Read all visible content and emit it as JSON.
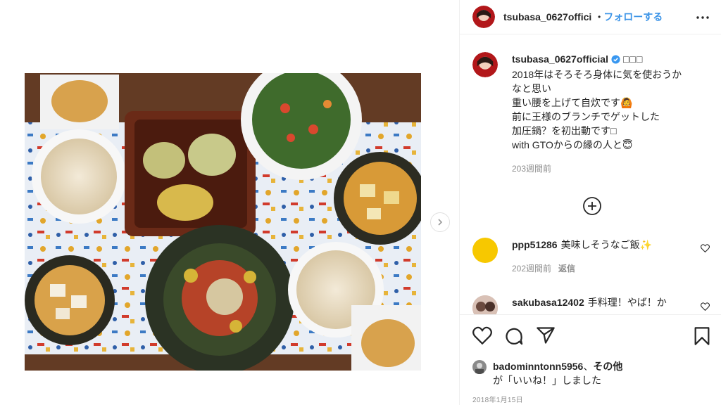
{
  "post": {
    "username": "tsubasa_0627official",
    "header_username": "tsubasa_0627offici",
    "separator": "•",
    "follow_label": "フォローする",
    "caption_deco": "□□□",
    "caption_lines": [
      "2018年はそろそろ身体に気を使おうか",
      "なと思い",
      "重い腰を上げて自炊です🙆",
      "前に王様のブランチでゲットした",
      "加圧鍋？を初出動です□",
      "with GTOからの縁の人と😇"
    ],
    "caption_time": "203週間前",
    "date": "2018年1月15日"
  },
  "comments": [
    {
      "username": "ppp51286",
      "text": "美味しそうなご飯✨",
      "time": "202週間前",
      "reply_label": "返信",
      "avatar_color": "#f7c800"
    },
    {
      "username": "sakubasa12402",
      "text": "手料理！やば！か",
      "avatar_color": "#c9a9a0"
    }
  ],
  "likes": {
    "username": "badominntonn5956",
    "joiner": "、",
    "others": "その他",
    "suffix": "が「いいね！」しました"
  },
  "icons": {
    "verified": "verified-badge-icon",
    "more": "more-options-icon",
    "next": "chevron-right-icon",
    "add": "add-comment-icon",
    "like": "heart-icon",
    "comment": "comment-icon",
    "share": "share-icon",
    "save": "bookmark-icon"
  },
  "colors": {
    "follow": "#3a93e7",
    "verified": "#3897f0",
    "muted": "#8e8e8e",
    "text": "#262626"
  }
}
